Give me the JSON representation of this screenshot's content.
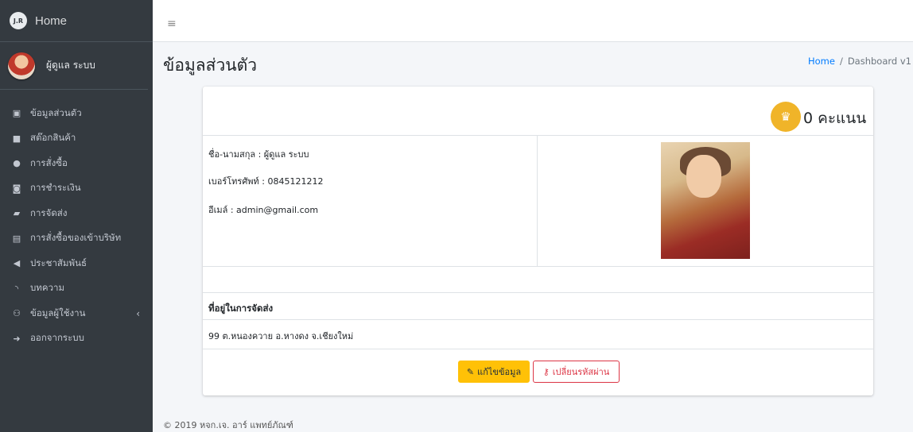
{
  "brand": {
    "logo_text": "J.R",
    "title": "Home"
  },
  "user": {
    "name": "ผู้ดูแล ระบบ"
  },
  "sidebar": {
    "items": [
      {
        "label": "ข้อมูลส่วนตัว",
        "icon": "id-card-icon",
        "glyph": "▣"
      },
      {
        "label": "สต๊อกสินค้า",
        "icon": "stock-icon",
        "glyph": "■"
      },
      {
        "label": "การสั่งซื้อ",
        "icon": "cube-icon",
        "glyph": "●"
      },
      {
        "label": "การชำระเงิน",
        "icon": "money-icon",
        "glyph": "◙"
      },
      {
        "label": "การจัดส่ง",
        "icon": "truck-icon",
        "glyph": "▰"
      },
      {
        "label": "การสั่งซื้อของเข้าบริษัท",
        "icon": "document-icon",
        "glyph": "▤"
      },
      {
        "label": "ประชาสัมพันธ์",
        "icon": "megaphone-icon",
        "glyph": "◀"
      },
      {
        "label": "บทความ",
        "icon": "rss-icon",
        "glyph": "◝"
      },
      {
        "label": "ข้อมูลผู้ใช้งาน",
        "icon": "user-icon",
        "glyph": "⚇",
        "caret": "‹"
      },
      {
        "label": "ออกจากระบบ",
        "icon": "sign-out-icon",
        "glyph": "➜"
      }
    ]
  },
  "topbar": {
    "menu_glyph": "≡"
  },
  "page": {
    "title": "ข้อมูลส่วนตัว"
  },
  "breadcrumb": {
    "home": "Home",
    "separator": "/",
    "current": "Dashboard v1"
  },
  "profile": {
    "points_value": "0",
    "points_unit": "คะแนน",
    "crown_glyph": "♛",
    "fullname_line": "ชื่อ-นามสกุล : ผู้ดูแล ระบบ",
    "phone_line": "เบอร์โทรศัพท์ : 0845121212",
    "email_line": "อีเมล์ : admin@gmail.com",
    "address_heading": "ที่อยู่ในการจัดส่ง",
    "address": "99 ต.หนองควาย อ.หางดง จ.เชียงใหม่"
  },
  "actions": {
    "edit_label": "แก้ไขข้อมูล",
    "edit_glyph": "✎",
    "password_label": "เปลี่ยนรหัสผ่าน",
    "password_glyph": "⚷"
  },
  "footer": {
    "text": "© 2019 หจก.เจ. อาร์ แพทย์ภัณฑ์"
  },
  "colors": {
    "sidebar_bg": "#343a40",
    "accent_link": "#007bff",
    "warning": "#ffc107",
    "danger": "#dc3545",
    "crown_badge": "#f0b429"
  }
}
